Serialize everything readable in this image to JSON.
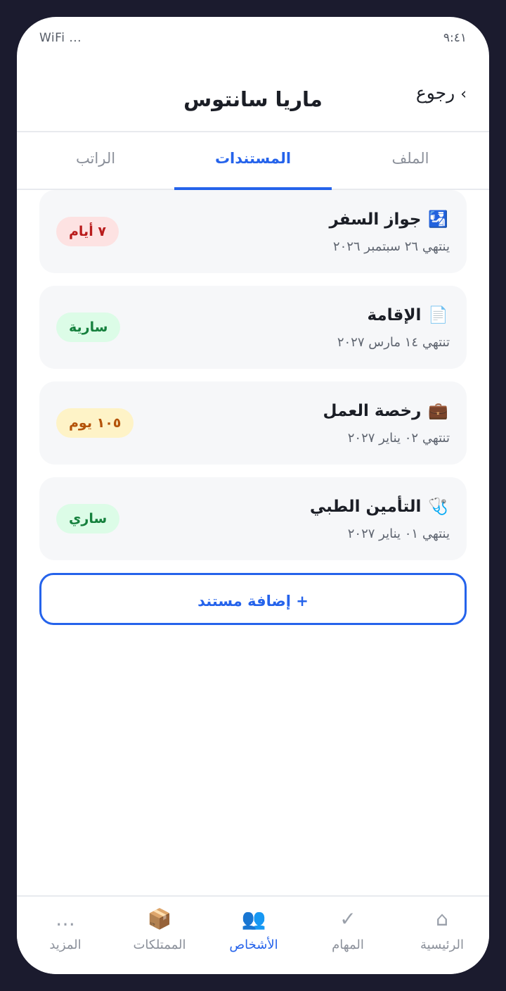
{
  "status_bar": {
    "time": "٩:٤١",
    "wifi": "WiFi ..."
  },
  "header": {
    "back_label": "رجوع",
    "back_icon": "chevron-right-icon",
    "title": "ماريا سانتوس"
  },
  "tabs": [
    {
      "label": "الملف",
      "active": false
    },
    {
      "label": "المستندات",
      "active": true
    },
    {
      "label": "الراتب",
      "active": false
    }
  ],
  "documents": [
    {
      "icon": "passport-icon",
      "glyph": "🛂",
      "name": "جواز السفر",
      "expiry": "ينتهي ٢٦ سبتمبر ٢٠٢٦",
      "badge": "٧ أيام",
      "status": "red",
      "color": "#b91c1c"
    },
    {
      "icon": "document-icon",
      "glyph": "📄",
      "name": "الإقامة",
      "expiry": "تنتهي ١٤ مارس ٢٠٢٧",
      "badge": "سارية",
      "status": "green",
      "color": "#15803d"
    },
    {
      "icon": "briefcase-icon",
      "glyph": "💼",
      "name": "رخصة العمل",
      "expiry": "تنتهي ٠٢ يناير ٢٠٢٧",
      "badge": "١٠٥ يوم",
      "status": "amber",
      "color": "#b45309"
    },
    {
      "icon": "stethoscope-icon",
      "glyph": "🩺",
      "name": "التأمين الطبي",
      "expiry": "ينتهي ٠١ يناير ٢٠٢٧",
      "badge": "ساري",
      "status": "green",
      "color": "#15803d"
    }
  ],
  "add_button": {
    "label": "+ إضافة مستند"
  },
  "bottom_nav": [
    {
      "label": "الرئيسية",
      "icon": "home-icon",
      "glyph": "⌂",
      "active": false
    },
    {
      "label": "المهام",
      "icon": "check-icon",
      "glyph": "✓",
      "active": false
    },
    {
      "label": "الأشخاص",
      "icon": "people-icon",
      "glyph": "👥",
      "active": true
    },
    {
      "label": "الممتلكات",
      "icon": "package-icon",
      "glyph": "📦",
      "active": false
    },
    {
      "label": "المزيد",
      "icon": "more-icon",
      "glyph": "…",
      "active": false
    }
  ],
  "colors": {
    "accent": "#2563eb",
    "frame": "#1b1b2e",
    "card_bg": "#f6f7f9"
  }
}
